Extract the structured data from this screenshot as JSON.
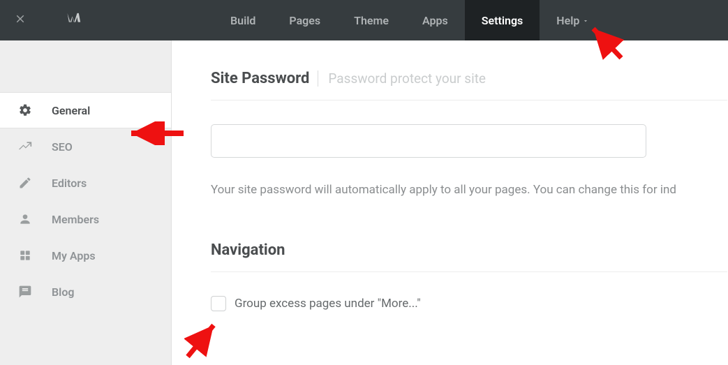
{
  "topnav": {
    "items": [
      {
        "label": "Build"
      },
      {
        "label": "Pages"
      },
      {
        "label": "Theme"
      },
      {
        "label": "Apps"
      },
      {
        "label": "Settings"
      },
      {
        "label": "Help"
      }
    ]
  },
  "sidebar": {
    "items": [
      {
        "label": "General"
      },
      {
        "label": "SEO"
      },
      {
        "label": "Editors"
      },
      {
        "label": "Members"
      },
      {
        "label": "My Apps"
      },
      {
        "label": "Blog"
      }
    ]
  },
  "password_section": {
    "title": "Site Password",
    "subtitle": "Password protect your site",
    "input_value": "",
    "help": "Your site password will automatically apply to all your pages. You can change this for ind"
  },
  "navigation_section": {
    "title": "Navigation",
    "checkbox_label": "Group excess pages under \"More...\""
  }
}
